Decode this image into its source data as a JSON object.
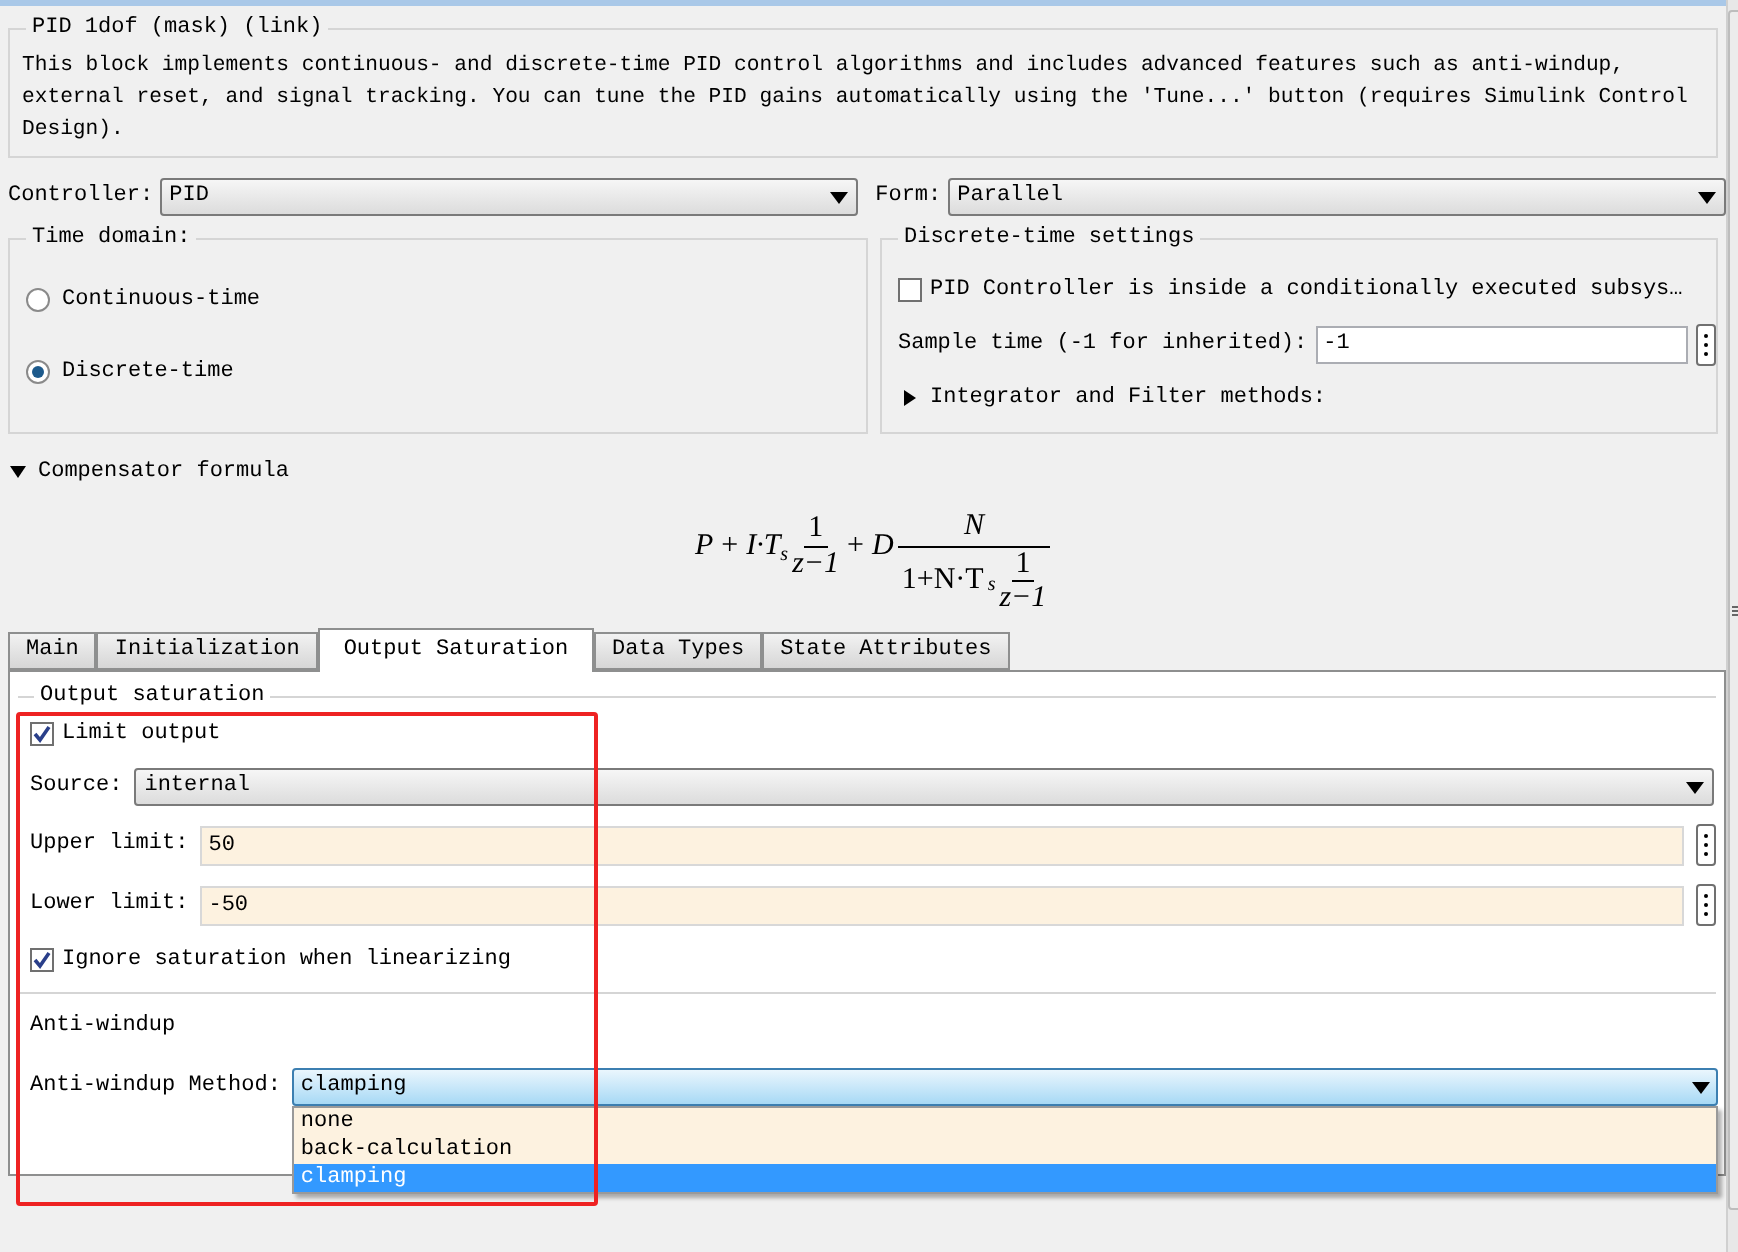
{
  "group_title": "PID 1dof (mask) (link)",
  "description": "This block implements continuous- and discrete-time PID control algorithms and includes advanced features such as anti-windup, external reset, and signal tracking. You can tune the PID gains automatically using the 'Tune...' button (requires Simulink Control Design).",
  "controller": {
    "label": "Controller:",
    "value": "PID"
  },
  "form": {
    "label": "Form:",
    "value": "Parallel"
  },
  "time_domain": {
    "title": "Time domain:",
    "options": [
      {
        "label": "Continuous-time",
        "selected": false
      },
      {
        "label": "Discrete-time",
        "selected": true
      }
    ]
  },
  "discrete_settings": {
    "title": "Discrete-time settings",
    "conditional": {
      "label": "PID Controller is inside a conditionally executed subsys…",
      "checked": false
    },
    "sample_time": {
      "label": "Sample time (-1 for inherited):",
      "value": "-1"
    },
    "methods": {
      "label": "Integrator and Filter methods:",
      "expanded": false
    }
  },
  "compensator": {
    "label": "Compensator formula",
    "expanded": true,
    "formula": {
      "p_term": "P",
      "plus_1": "+",
      "i_term": "I·T",
      "ts_sub": "s",
      "frac_num": "1",
      "frac_den": "z−1",
      "plus_2": "+",
      "d_term": "D",
      "big_num": "N",
      "den_lead": "1+N·T",
      "den_sub": "s",
      "den_frac_num": "1",
      "den_frac_den": "z−1"
    }
  },
  "tabs": [
    {
      "label": "Main",
      "selected": false
    },
    {
      "label": "Initialization",
      "selected": false
    },
    {
      "label": "Output Saturation",
      "selected": true
    },
    {
      "label": "Data Types",
      "selected": false
    },
    {
      "label": "State Attributes",
      "selected": false
    }
  ],
  "output_saturation": {
    "title": "Output saturation",
    "limit_output": {
      "label": "Limit output",
      "checked": true
    },
    "source": {
      "label": "Source:",
      "value": "internal"
    },
    "upper": {
      "label": "Upper limit:",
      "value": "50"
    },
    "lower": {
      "label": "Lower limit:",
      "value": "-50"
    },
    "ignore": {
      "label": "Ignore saturation when linearizing",
      "checked": true
    }
  },
  "anti_windup": {
    "title": "Anti-windup",
    "method": {
      "label": "Anti-windup Method:",
      "value": "clamping",
      "options": [
        {
          "label": "none",
          "selected": false
        },
        {
          "label": "back-calculation",
          "selected": false
        },
        {
          "label": "clamping",
          "selected": true
        }
      ]
    }
  }
}
